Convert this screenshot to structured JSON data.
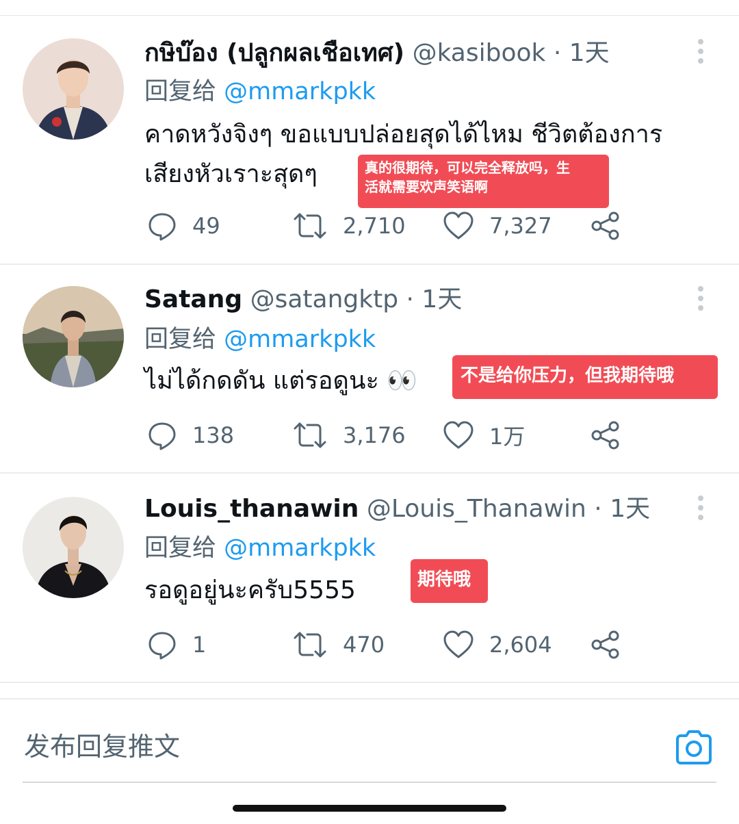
{
  "tweets": [
    {
      "display_name": "กษิบ๊อง (ปลูกผลเชือเทศ)",
      "handle": "@kasibook",
      "separator": "·",
      "time": "1天",
      "reply_prefix": "回复给",
      "reply_target": "@mmarkpkk",
      "text_lines": [
        "คาดหวังจิงๆ ขอแบบปล่อยสุดได้ไหม ชีวิตต้องการ",
        "เสียงหัวเราะสุดๆ"
      ],
      "annotation_lines": [
        "真的很期待，可以完全释放吗，生",
        "活就需要欢声笑语啊"
      ],
      "replies": "49",
      "retweets": "2,710",
      "likes": "7,327"
    },
    {
      "display_name": "Satang",
      "handle": "@satangktp",
      "separator": "·",
      "time": "1天",
      "reply_prefix": "回复给",
      "reply_target": "@mmarkpkk",
      "text_lines": [
        "ไม่ได้กดดัน แต่รอดูนะ 👀"
      ],
      "annotation_lines": [
        "不是给你压力，但我期待哦"
      ],
      "replies": "138",
      "retweets": "3,176",
      "likes": "1万"
    },
    {
      "display_name": "Louis_thanawin",
      "handle": "@Louis_Thanawin",
      "separator": "·",
      "time": "1天",
      "reply_prefix": "回复给",
      "reply_target": "@mmarkpkk",
      "text_lines": [
        "รอดูอยู่นะครับ5555"
      ],
      "annotation_lines": [
        "期待哦"
      ],
      "replies": "1",
      "retweets": "470",
      "likes": "2,604"
    }
  ],
  "composer": {
    "placeholder": "发布回复推文"
  },
  "icons": {
    "reply": "reply-icon",
    "retweet": "retweet-icon",
    "like": "heart-icon",
    "share": "share-icon",
    "more": "more-options-icon",
    "camera": "camera-icon"
  },
  "colors": {
    "link": "#1d9bf0",
    "secondary_text": "#536471",
    "annotation_bg": "#f14c55"
  }
}
